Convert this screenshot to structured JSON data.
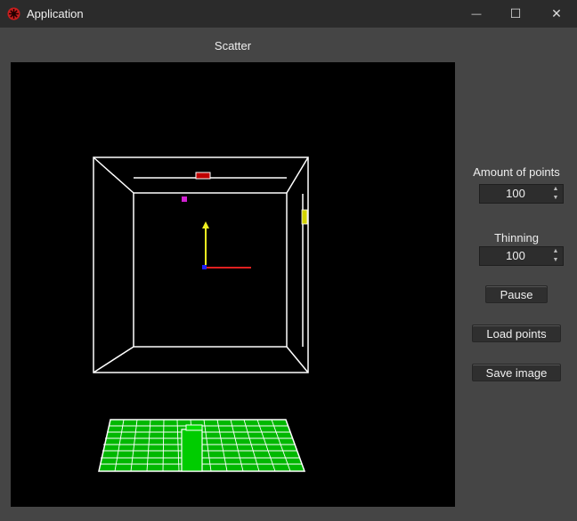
{
  "window": {
    "title": "Application",
    "minimize_glyph": "—",
    "maximize_glyph": "☐",
    "close_glyph": "✕"
  },
  "scene": {
    "title": "Scatter",
    "axis_colors": {
      "x": "#e02020",
      "y": "#f0f020",
      "z": "#2020ff"
    },
    "point_color": "#d020d0",
    "floor_color": "#00cc00",
    "x_slider_color": "#c00000",
    "y_slider_color": "#d4d400"
  },
  "controls": {
    "amount_label": "Amount of points",
    "amount_value": "100",
    "thinning_label": "Thinning",
    "thinning_value": "100",
    "pause_label": "Pause",
    "load_label": "Load points",
    "save_label": "Save image"
  },
  "icons": {
    "app": "app-icon",
    "spin_up": "spin-up-arrow-icon",
    "spin_down": "spin-down-arrow-icon"
  }
}
